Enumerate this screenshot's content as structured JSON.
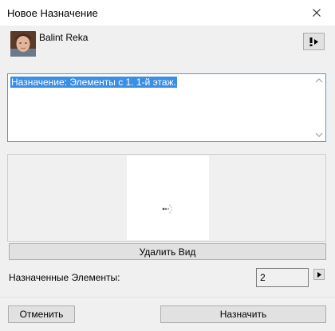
{
  "window": {
    "title": "Новое Назначение",
    "close_icon": "close-icon"
  },
  "user": {
    "name": "Balint Reka",
    "avatar_icon": "user-avatar"
  },
  "alert_button": {
    "icon": "exclamation-dropdown-icon"
  },
  "description": {
    "text": "Назначение: Элементы с 1. 1-й этаж."
  },
  "view": {
    "delete_label": "Удалить Вид",
    "loading_icon": "loading-spinner-icon"
  },
  "assigned": {
    "label": "Назначенные Элементы:",
    "count": "2"
  },
  "actions": {
    "cancel_label": "Отменить",
    "assign_label": "Назначить"
  }
}
